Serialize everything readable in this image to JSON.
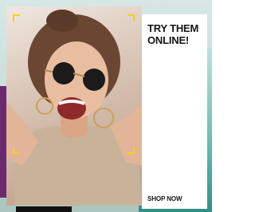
{
  "ad": {
    "headline": "TRY THEM ONLINE!",
    "cta_label": "SHOP NOW"
  },
  "colors": {
    "frame_accent": "#f2d21e",
    "panel_background": "#ffffff",
    "text": "#141414",
    "side_accent": "#6b2a6d",
    "background_teal": "#6fb6ad"
  }
}
